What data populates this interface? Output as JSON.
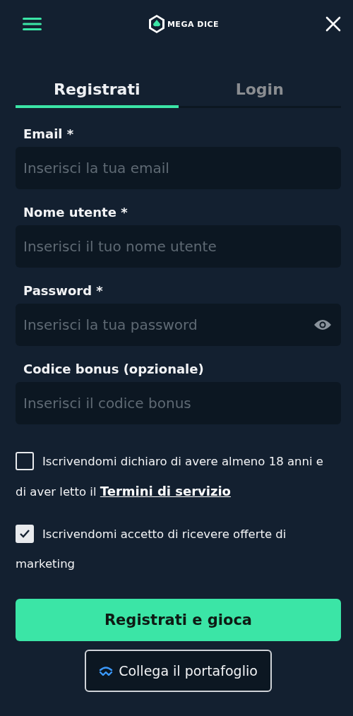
{
  "header": {
    "logo_text": "MEGA DICE"
  },
  "tabs": [
    {
      "label": "Registrati",
      "selected": true
    },
    {
      "label": "Login",
      "selected": false
    }
  ],
  "fields": [
    {
      "label": "Email *",
      "placeholder": "Inserisci la tua email",
      "kind": "text"
    },
    {
      "label": "Nome utente *",
      "placeholder": "Inserisci il tuo nome utente",
      "kind": "text"
    },
    {
      "label": "Password *",
      "placeholder": "Inserisci la tua password",
      "kind": "password"
    },
    {
      "label": "Codice bonus (opzionale)",
      "placeholder": "Inserisci il codice bonus",
      "kind": "text"
    }
  ],
  "agreements": [
    {
      "text": "Iscrivendomi dichiaro di avere almeno 18 anni e di aver letto il",
      "link": "Termini di servizio",
      "checked": false
    },
    {
      "text": "Iscrivendomi accetto di ricevere offerte di marketing",
      "checked": true
    }
  ],
  "submit_button": "Registrati e gioca",
  "wallet_button": "Collega il portafoglio"
}
